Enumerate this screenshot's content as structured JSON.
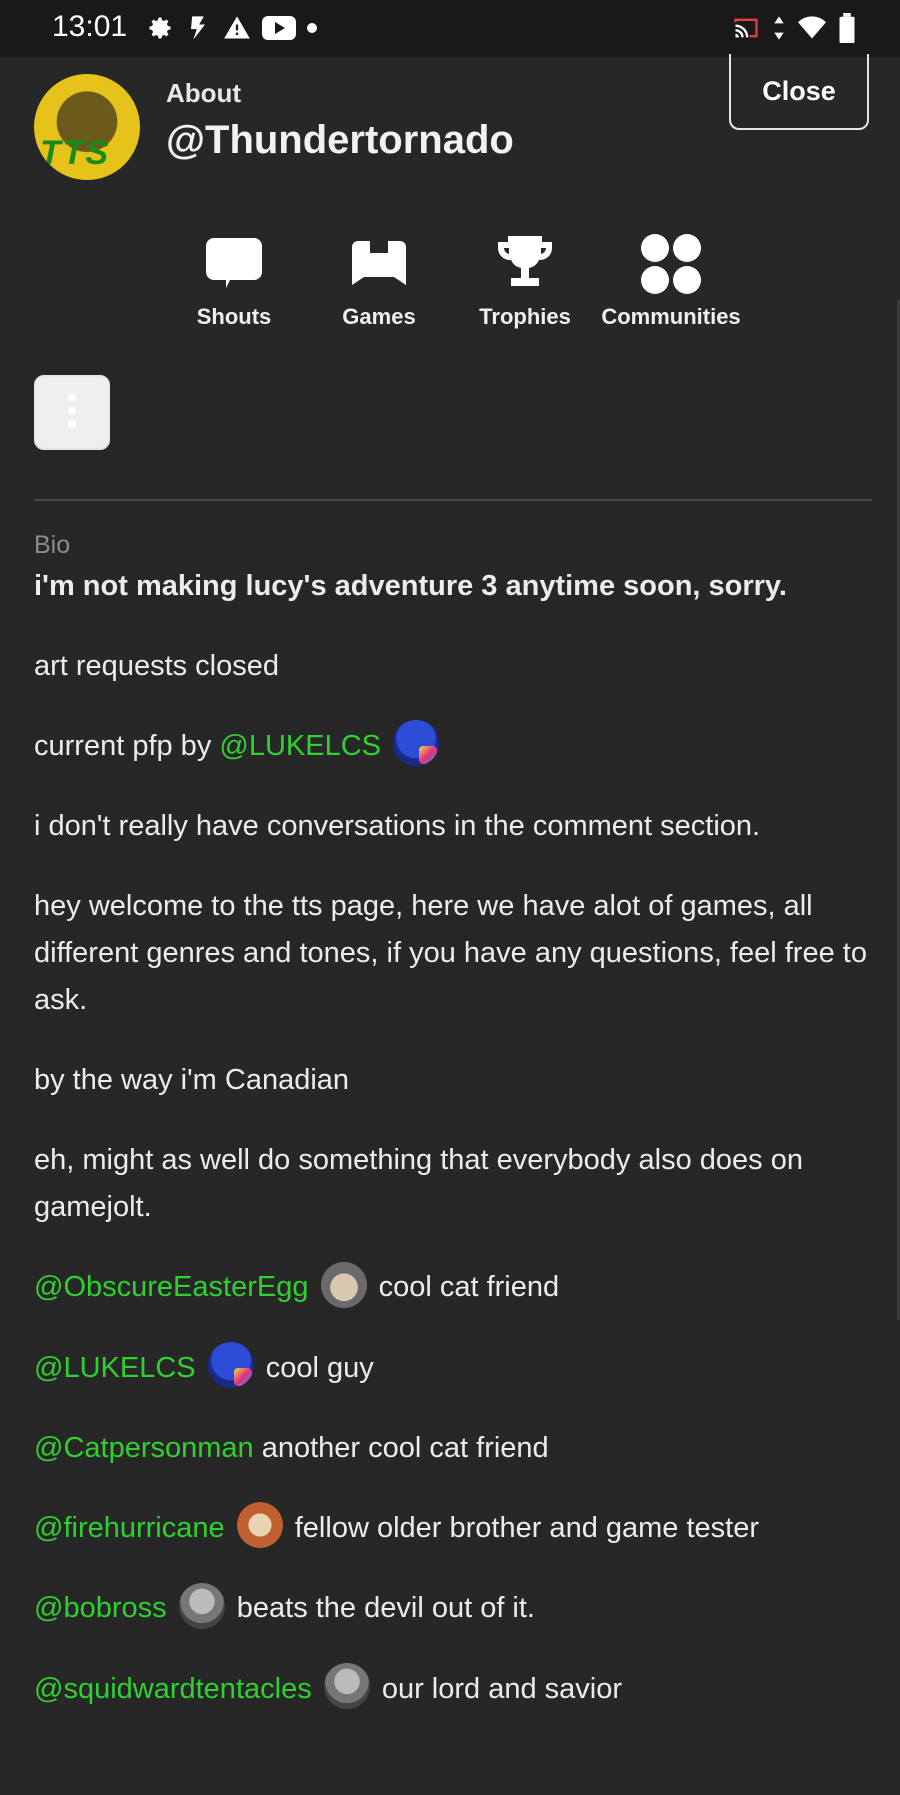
{
  "status_bar": {
    "time": "13:01",
    "left_icons": [
      "gear-icon",
      "flash-icon",
      "warning-icon",
      "youtube-icon",
      "dot-icon"
    ],
    "right_icons": [
      "cast-icon",
      "data-arrows-icon",
      "wifi-icon",
      "battery-icon"
    ]
  },
  "header": {
    "about_label": "About",
    "username": "@Thundertornado",
    "avatar_text": "TTS",
    "close_label": "Close"
  },
  "nav": {
    "items": [
      {
        "label": "Shouts",
        "icon": "chat-bubble-icon"
      },
      {
        "label": "Games",
        "icon": "gamepad-icon"
      },
      {
        "label": "Trophies",
        "icon": "trophy-icon"
      },
      {
        "label": "Communities",
        "icon": "communities-icon"
      }
    ]
  },
  "more_button": {
    "icon": "more-vertical-icon"
  },
  "bio": {
    "label": "Bio",
    "headline": "i'm not making lucy's adventure 3 anytime soon, sorry.",
    "art_requests": "art requests closed",
    "pfp_prefix": "current pfp by",
    "pfp_mention": "@LUKELCS",
    "conversations": "i don't really have conversations in the comment section.",
    "welcome": "hey welcome to the tts page, here we have alot of games, all different genres and tones, if you have any questions, feel free to ask.",
    "canadian": "by the way i'm Canadian",
    "gamejolt": "eh, might as well do something that everybody also does on gamejolt.",
    "friends": [
      {
        "mention": "@ObscureEasterEgg",
        "text": "cool cat friend",
        "avatar": "cat"
      },
      {
        "mention": "@LUKELCS",
        "text": "cool guy",
        "avatar": "luke"
      },
      {
        "mention": "@Catpersonman",
        "text": "another cool cat friend",
        "avatar": ""
      },
      {
        "mention": "@firehurricane",
        "text": "fellow older brother and game tester",
        "avatar": "fire"
      },
      {
        "mention": "@bobross",
        "text": "beats the devil out of it.",
        "avatar": "bob"
      },
      {
        "mention": "@squidwardtentacles",
        "text": "our lord and savior",
        "avatar": "bob"
      }
    ]
  }
}
